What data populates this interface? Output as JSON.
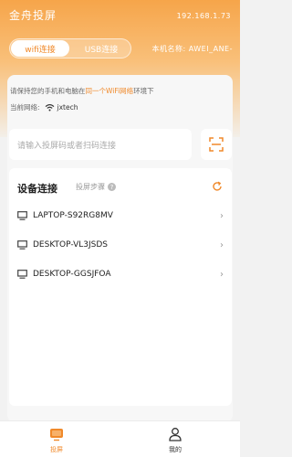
{
  "header": {
    "app_title": "金舟投屏",
    "ip": "192.168.1.73",
    "device_name": "本机名称: AWEI_ANE-"
  },
  "tabs": {
    "wifi": "wifi连接",
    "usb": "USB连接"
  },
  "tip": {
    "before": "请保持您的手机和电脑在",
    "highlight": "同一个WiFi网络",
    "after": "环境下"
  },
  "network": {
    "label": "当前网络:",
    "ssid": "jxtech"
  },
  "search": {
    "placeholder": "请输入投屏码或者扫码连接"
  },
  "devices_section": {
    "title": "设备连接",
    "steps_label": "投屏步骤",
    "items": [
      {
        "name": "LAPTOP-S92RG8MV"
      },
      {
        "name": "DESKTOP-VL3JSDS"
      },
      {
        "name": "DESKTOP-GGSJFOA"
      }
    ]
  },
  "bottom_nav": {
    "screen": "投屏",
    "mine": "我的"
  },
  "colors": {
    "accent": "#f0892a",
    "gradient_top": "#f6a54a"
  }
}
